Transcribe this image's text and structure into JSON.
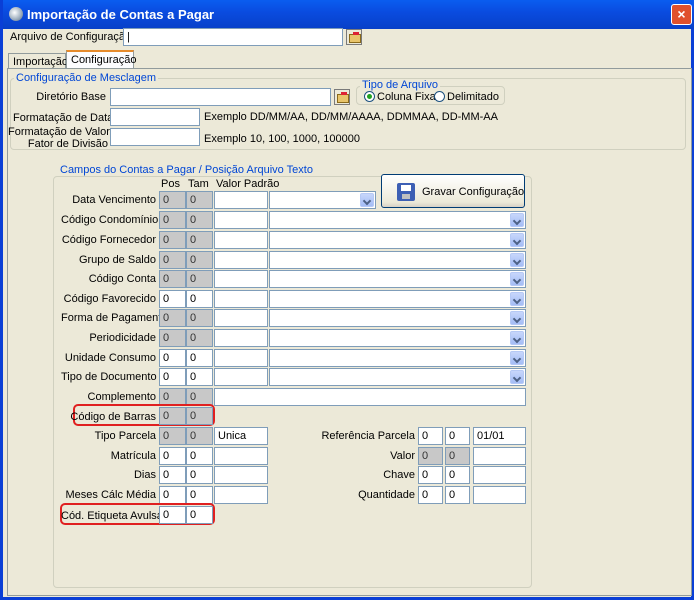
{
  "window": {
    "title": "Importação de Contas a Pagar",
    "close_glyph": "×"
  },
  "config_file": {
    "label": "Arquivo de Configuração",
    "value": "|"
  },
  "tabs": [
    {
      "label": "Importação"
    },
    {
      "label": "Configuração"
    }
  ],
  "merge_group": {
    "title": "Configuração de Mesclagem",
    "base_dir_label": "Diretório Base",
    "date_format_label": "Formatação de Data",
    "date_example": "Exemplo DD/MM/AA, DD/MM/AAAA, DDMMAA, DD-MM-AA",
    "value_format_label_1": "Formatação de Valor -",
    "value_format_label_2": "Fator de Divisão",
    "value_example": "Exemplo 10, 100, 1000, 100000",
    "file_type": {
      "title": "Tipo de Arquivo",
      "option_fixed": "Coluna Fixa",
      "option_delimited": "Delimitado",
      "selected": "Coluna Fixa"
    }
  },
  "fields_group": {
    "title": "Campos do Contas a Pagar / Posição Arquivo Texto",
    "col_pos": "Pos",
    "col_tam": "Tam",
    "col_default": "Valor Padrão",
    "save_button": "Gravar Configuração",
    "rows": [
      {
        "label": "Data Vencimento",
        "pos": "0",
        "tam": "0",
        "default": ""
      },
      {
        "label": "Código Condomínio",
        "pos": "0",
        "tam": "0",
        "default": ""
      },
      {
        "label": "Código Fornecedor",
        "pos": "0",
        "tam": "0",
        "default": ""
      },
      {
        "label": "Grupo de Saldo",
        "pos": "0",
        "tam": "0",
        "default": ""
      },
      {
        "label": "Código Conta",
        "pos": "0",
        "tam": "0",
        "default": ""
      },
      {
        "label": "Código Favorecido",
        "pos": "0",
        "tam": "0",
        "default": ""
      },
      {
        "label": "Forma de Pagamento",
        "pos": "0",
        "tam": "0",
        "default": ""
      },
      {
        "label": "Periodicidade",
        "pos": "0",
        "tam": "0",
        "default": ""
      },
      {
        "label": "Unidade Consumo",
        "pos": "0",
        "tam": "0",
        "default": ""
      },
      {
        "label": "Tipo de Documento",
        "pos": "0",
        "tam": "0",
        "default": ""
      },
      {
        "label": "Complemento",
        "pos": "0",
        "tam": "0",
        "default": ""
      },
      {
        "label": "Código de Barras",
        "pos": "0",
        "tam": "0"
      },
      {
        "label": "Tipo Parcela",
        "pos": "0",
        "tam": "0",
        "default": "Unica"
      },
      {
        "label": "Matrícula",
        "pos": "0",
        "tam": "0",
        "default": ""
      },
      {
        "label": "Dias",
        "pos": "0",
        "tam": "0",
        "default": ""
      },
      {
        "label": "Meses Cálc Média",
        "pos": "0",
        "tam": "0",
        "default": ""
      },
      {
        "label": "Cód. Etiqueta Avulsa",
        "pos": "0",
        "tam": "0"
      }
    ],
    "right_rows": [
      {
        "label": "Referência Parcela",
        "pos": "0",
        "tam": "0",
        "default": "01/01"
      },
      {
        "label": "Valor",
        "pos": "0",
        "tam": "0",
        "default": ""
      },
      {
        "label": "Chave",
        "pos": "0",
        "tam": "0",
        "default": ""
      },
      {
        "label": "Quantidade",
        "pos": "0",
        "tam": "0",
        "default": ""
      }
    ]
  },
  "colors": {
    "titlebar": "#0a4ce0",
    "highlight": "#e02020",
    "group_title": "#0046d5",
    "disabled_field": "#c8c8c8"
  },
  "icons": [
    "app-icon",
    "close-icon",
    "folder-browse-icon",
    "save-disk-icon",
    "chevron-down-icon"
  ]
}
